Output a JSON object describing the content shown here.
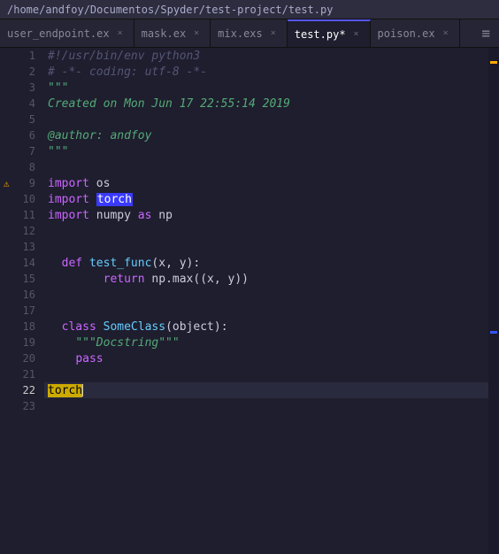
{
  "titleBar": {
    "path": "/home/andfoy/Documentos/Spyder/test-project/test.py"
  },
  "tabs": [
    {
      "id": "tab-user-endpoint",
      "label": "user_endpoint.ex",
      "modified": false,
      "active": false
    },
    {
      "id": "tab-mask",
      "label": "mask.ex",
      "modified": false,
      "active": false
    },
    {
      "id": "tab-mix",
      "label": "mix.exs",
      "modified": false,
      "active": false
    },
    {
      "id": "tab-test",
      "label": "test.py",
      "modified": true,
      "active": true
    },
    {
      "id": "tab-poison",
      "label": "poison.ex",
      "modified": false,
      "active": false
    }
  ],
  "tabMenu": "≡",
  "codeLines": [
    {
      "num": 1,
      "content": "#!/usr/bin/env python3",
      "type": "comment"
    },
    {
      "num": 2,
      "content": "# -*- coding: utf-8 -*-",
      "type": "comment"
    },
    {
      "num": 3,
      "content": "\"\"\"",
      "type": "docstring"
    },
    {
      "num": 4,
      "content": "Created on Mon Jun 17 22:55:14 2019",
      "type": "docstring-content"
    },
    {
      "num": 5,
      "content": "",
      "type": "empty"
    },
    {
      "num": 6,
      "content": "@author: andfoy",
      "type": "docstring-content"
    },
    {
      "num": 7,
      "content": "\"\"\"",
      "type": "docstring"
    },
    {
      "num": 8,
      "content": "",
      "type": "empty"
    },
    {
      "num": 9,
      "content": "import os",
      "type": "import",
      "warning": true
    },
    {
      "num": 10,
      "content": "import torch",
      "type": "import-highlight"
    },
    {
      "num": 11,
      "content": "import numpy as np",
      "type": "import"
    },
    {
      "num": 12,
      "content": "",
      "type": "empty"
    },
    {
      "num": 13,
      "content": "",
      "type": "empty"
    },
    {
      "num": 14,
      "content": "def test_func(x, y):",
      "type": "def"
    },
    {
      "num": 15,
      "content": "    return np.max((x, y))",
      "type": "code"
    },
    {
      "num": 16,
      "content": "",
      "type": "empty"
    },
    {
      "num": 17,
      "content": "",
      "type": "empty"
    },
    {
      "num": 18,
      "content": "class SomeClass(object):",
      "type": "class"
    },
    {
      "num": 19,
      "content": "    \"\"\"Docstring\"\"\"",
      "type": "docstring-inline"
    },
    {
      "num": 20,
      "content": "    pass",
      "type": "code"
    },
    {
      "num": 21,
      "content": "",
      "type": "empty"
    },
    {
      "num": 22,
      "content": "torch",
      "type": "active",
      "cursor": true
    },
    {
      "num": 23,
      "content": "",
      "type": "empty"
    }
  ]
}
